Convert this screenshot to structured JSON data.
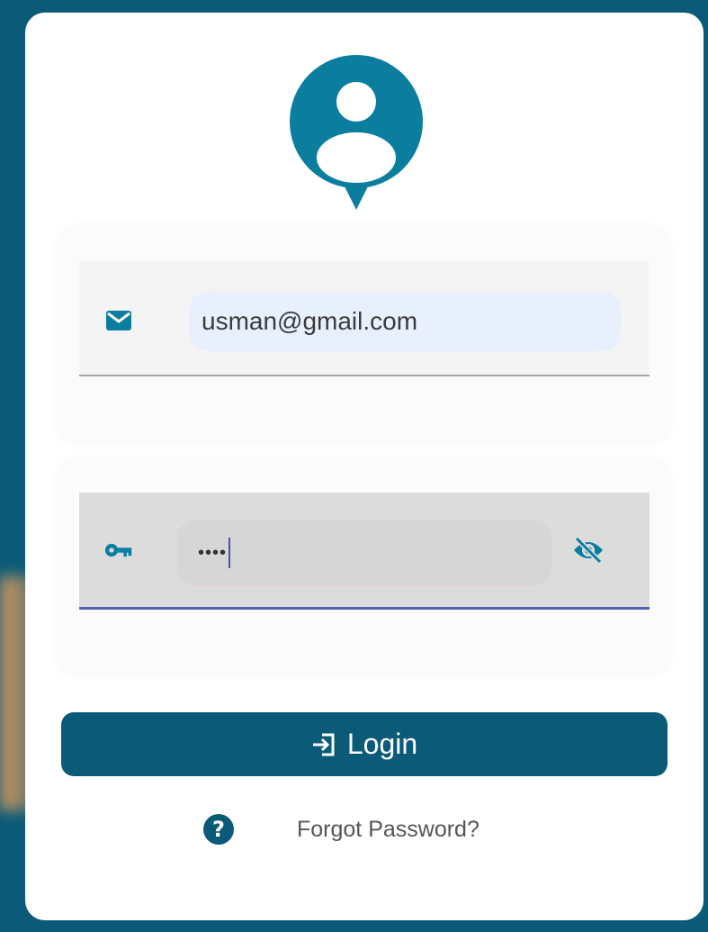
{
  "login_form": {
    "avatar_icon": "user-location-pin-icon",
    "email": {
      "icon": "envelope-icon",
      "value": "usman@gmail.com"
    },
    "password": {
      "icon": "key-icon",
      "value": "••••",
      "visibility_icon": "eye-off-icon"
    },
    "login_button": {
      "icon": "login-arrow-icon",
      "label": "Login"
    },
    "forgot": {
      "icon": "help-circle-icon",
      "icon_glyph": "?",
      "label": "Forgot Password?"
    }
  },
  "colors": {
    "primary": "#0b5b78",
    "autofill_bg": "#e8f0fe",
    "focus_underline": "#5362b0"
  }
}
